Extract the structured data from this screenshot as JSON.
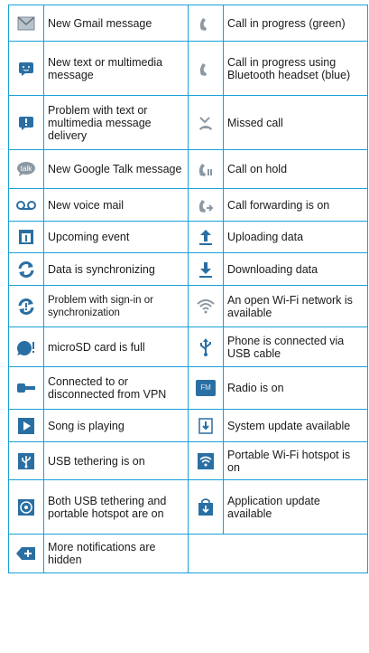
{
  "colors": {
    "border": "#1aa0d8",
    "icon_blue": "#2a6fa3",
    "icon_gray": "#8c98a2"
  },
  "rows": [
    {
      "left": {
        "icon": "gmail-icon",
        "label": "New Gmail message"
      },
      "right": {
        "icon": "call-in-progress-green-icon",
        "label": "Call in progress (green)"
      }
    },
    {
      "left": {
        "icon": "text-message-icon",
        "label": "New text or multimedia message"
      },
      "right": {
        "icon": "call-bluetooth-icon",
        "label": "Call in progress using Bluetooth headset (blue)"
      }
    },
    {
      "left": {
        "icon": "message-problem-icon",
        "label": "Problem with text or multimedia message delivery"
      },
      "right": {
        "icon": "missed-call-icon",
        "label": "Missed call"
      }
    },
    {
      "left": {
        "icon": "google-talk-icon",
        "label": "New Google Talk message"
      },
      "right": {
        "icon": "call-on-hold-icon",
        "label": "Call on hold"
      }
    },
    {
      "left": {
        "icon": "voicemail-icon",
        "label": "New voice mail"
      },
      "right": {
        "icon": "call-forwarding-icon",
        "label": "Call forwarding is on"
      }
    },
    {
      "left": {
        "icon": "calendar-icon",
        "label": "Upcoming event"
      },
      "right": {
        "icon": "upload-icon",
        "label": "Uploading data"
      }
    },
    {
      "left": {
        "icon": "sync-icon",
        "label": "Data is synchronizing"
      },
      "right": {
        "icon": "download-icon",
        "label": "Downloading data"
      }
    },
    {
      "left": {
        "icon": "sync-problem-icon",
        "label": "Problem with sign-in or synchronization"
      },
      "right": {
        "icon": "open-wifi-icon",
        "label": "An open Wi-Fi network is available"
      }
    },
    {
      "left": {
        "icon": "sd-card-full-icon",
        "label": "microSD card is full"
      },
      "right": {
        "icon": "usb-icon",
        "label": "Phone is connected via USB cable"
      }
    },
    {
      "left": {
        "icon": "vpn-key-icon",
        "label": "Connected to or disconnected from VPN"
      },
      "right": {
        "icon": "radio-icon",
        "label": "Radio is on",
        "icon_text": "FM"
      }
    },
    {
      "left": {
        "icon": "play-icon",
        "label": "Song is playing"
      },
      "right": {
        "icon": "system-update-icon",
        "label": "System update available"
      }
    },
    {
      "left": {
        "icon": "usb-tethering-icon",
        "label": "USB tethering is on"
      },
      "right": {
        "icon": "portable-hotspot-icon",
        "label": "Portable Wi-Fi hotspot is on"
      }
    },
    {
      "left": {
        "icon": "tethering-hotspot-icon",
        "label": "Both USB tethering and portable hotspot are on"
      },
      "right": {
        "icon": "app-update-icon",
        "label": "Application update available"
      }
    },
    {
      "left": {
        "icon": "more-notifications-icon",
        "label": "More notifications are hidden"
      },
      "right": null
    }
  ]
}
